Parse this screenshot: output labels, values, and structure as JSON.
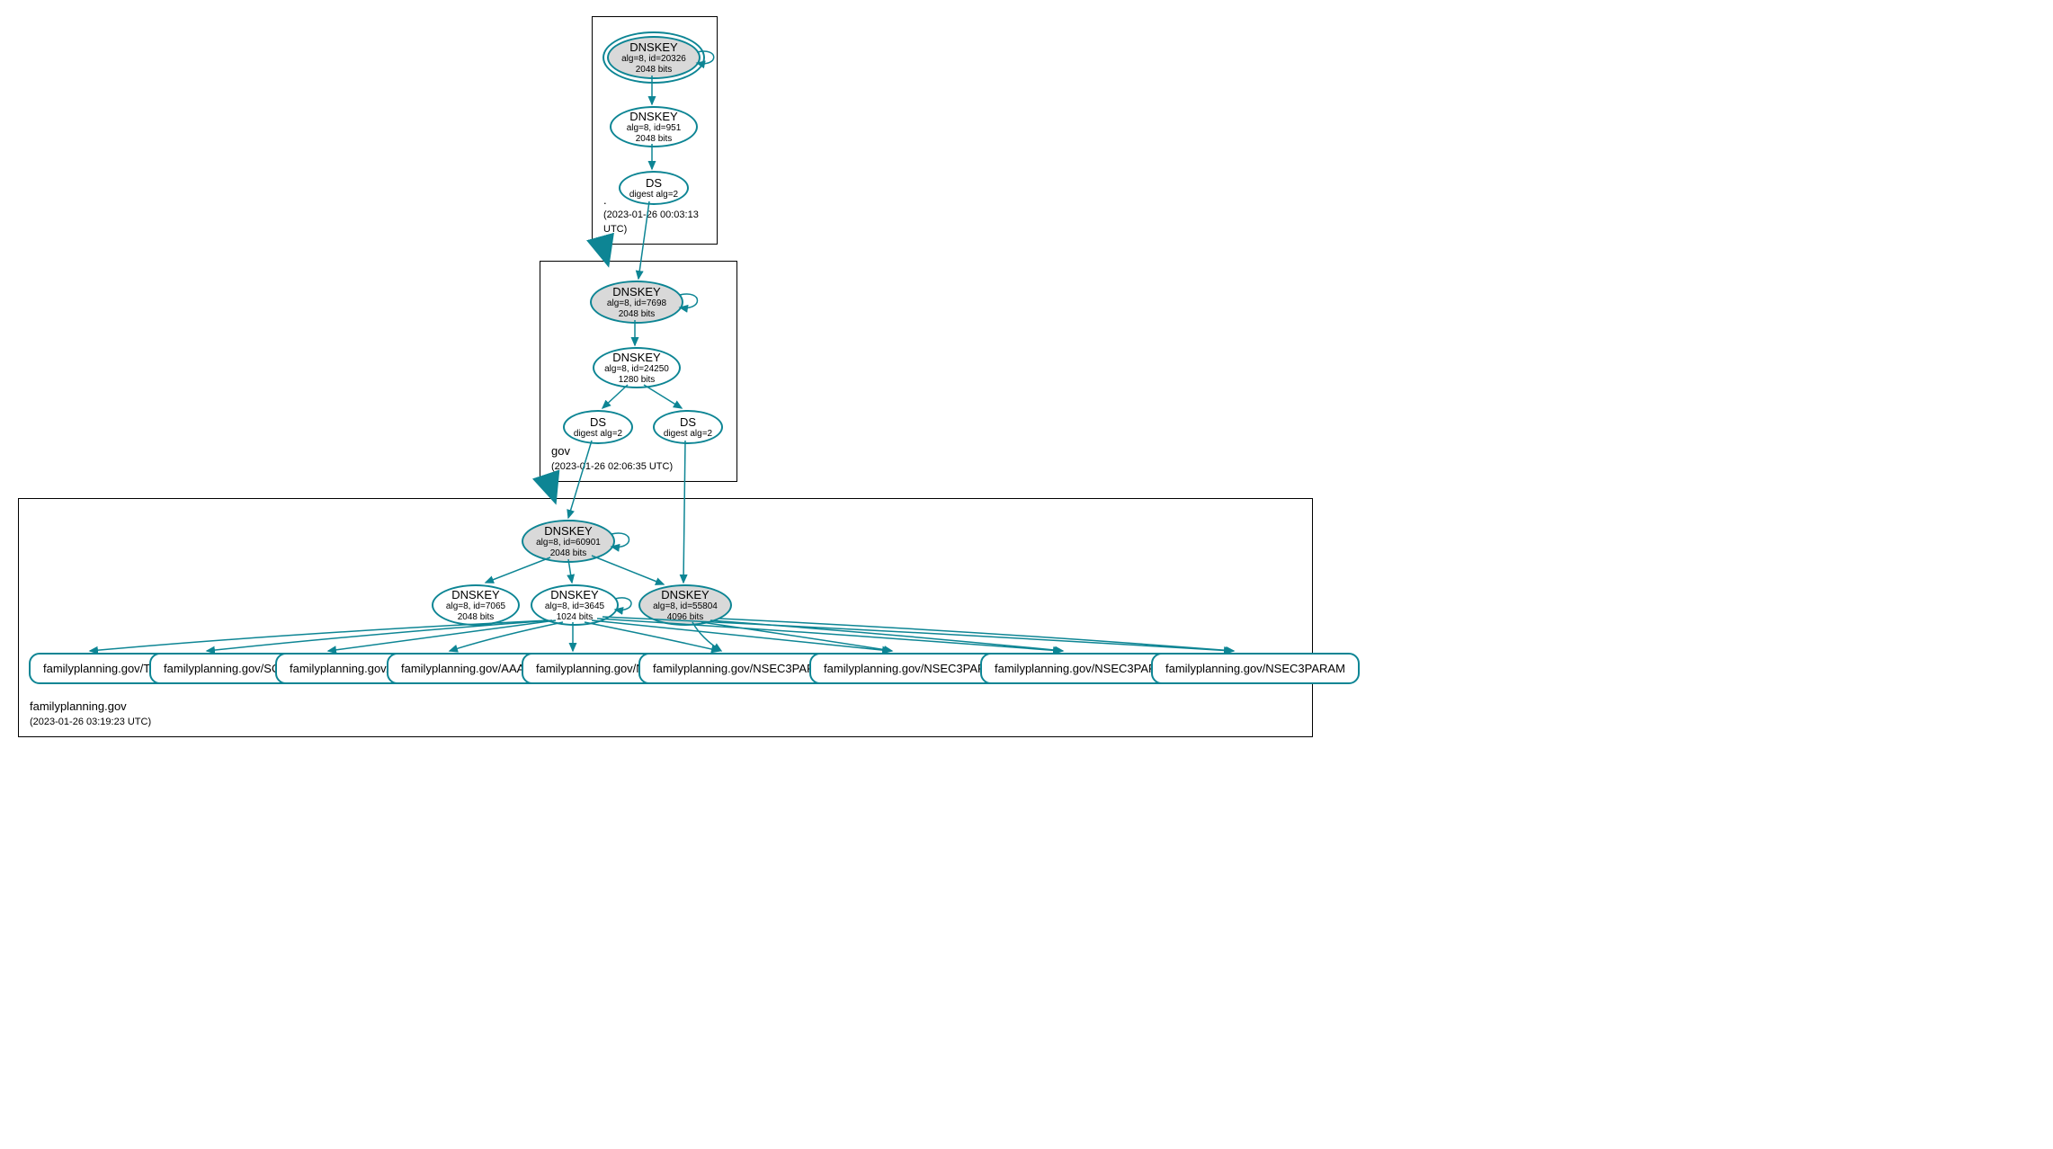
{
  "zones": {
    "root": {
      "name": ".",
      "timestamp": "(2023-01-26 00:03:13 UTC)"
    },
    "gov": {
      "name": "gov",
      "timestamp": "(2023-01-26 02:06:35 UTC)"
    },
    "domain": {
      "name": "familyplanning.gov",
      "timestamp": "(2023-01-26 03:19:23 UTC)"
    }
  },
  "nodes": {
    "root_ksk": {
      "title": "DNSKEY",
      "line1": "alg=8, id=20326",
      "line2": "2048 bits"
    },
    "root_zsk": {
      "title": "DNSKEY",
      "line1": "alg=8, id=951",
      "line2": "2048 bits"
    },
    "root_ds": {
      "title": "DS",
      "line1": "digest alg=2"
    },
    "gov_ksk": {
      "title": "DNSKEY",
      "line1": "alg=8, id=7698",
      "line2": "2048 bits"
    },
    "gov_zsk": {
      "title": "DNSKEY",
      "line1": "alg=8, id=24250",
      "line2": "1280 bits"
    },
    "gov_ds1": {
      "title": "DS",
      "line1": "digest alg=2"
    },
    "gov_ds2": {
      "title": "DS",
      "line1": "digest alg=2"
    },
    "dom_ksk": {
      "title": "DNSKEY",
      "line1": "alg=8, id=60901",
      "line2": "2048 bits"
    },
    "dom_k1": {
      "title": "DNSKEY",
      "line1": "alg=8, id=7065",
      "line2": "2048 bits"
    },
    "dom_k2": {
      "title": "DNSKEY",
      "line1": "alg=8, id=3645",
      "line2": "1024 bits"
    },
    "dom_k3": {
      "title": "DNSKEY",
      "line1": "alg=8, id=55804",
      "line2": "4096 bits"
    },
    "rr_txt": "familyplanning.gov/TXT",
    "rr_soa": "familyplanning.gov/SOA",
    "rr_a": "familyplanning.gov/A",
    "rr_aaaa": "familyplanning.gov/AAAA",
    "rr_ns": "familyplanning.gov/NS",
    "rr_nsec1": "familyplanning.gov/NSEC3PARAM",
    "rr_nsec2": "familyplanning.gov/NSEC3PARAM",
    "rr_nsec3": "familyplanning.gov/NSEC3PARAM",
    "rr_nsec4": "familyplanning.gov/NSEC3PARAM"
  }
}
